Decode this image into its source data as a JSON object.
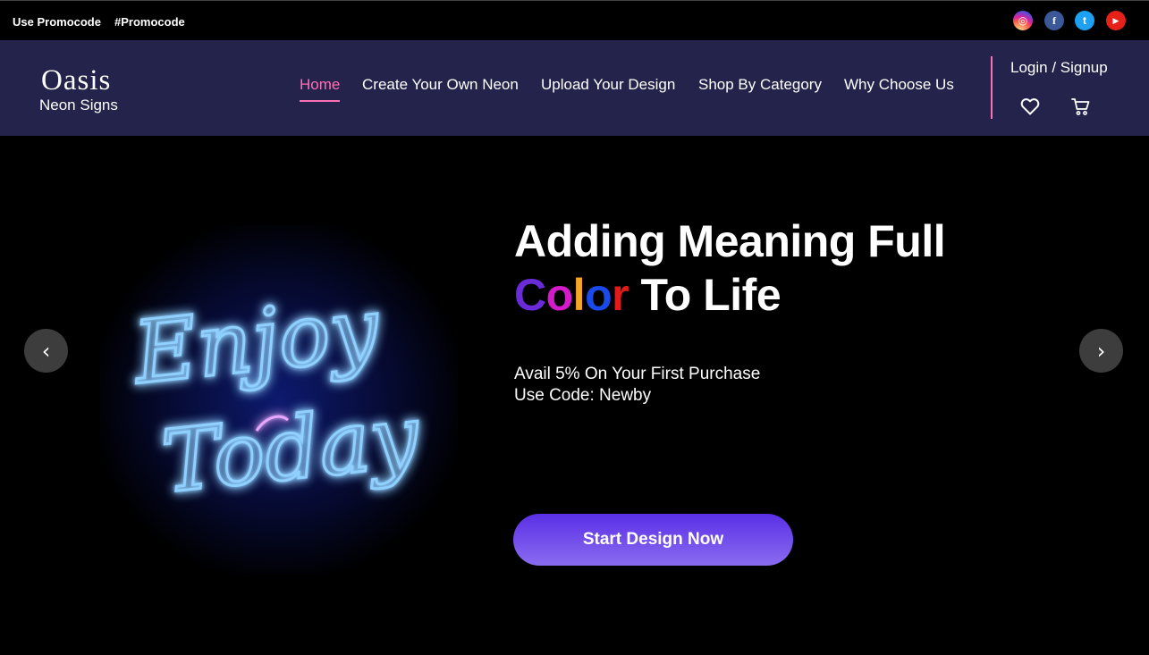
{
  "promo": {
    "left_text": "Use Promocode",
    "right_text": "#Promocode"
  },
  "social": {
    "instagram_glyph": "◎",
    "facebook_glyph": "f",
    "twitter_glyph": "t",
    "youtube_glyph": "▶"
  },
  "logo": {
    "main": "Oasis",
    "sub": "Neon Signs"
  },
  "nav": {
    "home": "Home",
    "create": "Create Your Own Neon",
    "upload": "Upload Your Design",
    "shop": "Shop By Category",
    "why": "Why Choose Us",
    "login": "Login / Signup"
  },
  "hero": {
    "headline_line1": "Adding  Meaning Full",
    "color_word": [
      "C",
      "o",
      "l",
      "o",
      "r"
    ],
    "headline_rest": " To Life",
    "offer_line1": "Avail 5% On Your First Purchase",
    "offer_line2": "Use Code: Newby",
    "cta_label": "Start Design Now",
    "prev_glyph": "‹",
    "next_glyph": "›"
  },
  "neon_sign": {
    "line1": "Enjoy",
    "line2": "Today"
  },
  "colors": {
    "navbar_bg": "#23234b",
    "accent_pink": "#ff6fb5",
    "cta_gradient_top": "#5a2fe6",
    "cta_gradient_bottom": "#8a6cf0",
    "neon_blue": "#8fd0ff"
  }
}
